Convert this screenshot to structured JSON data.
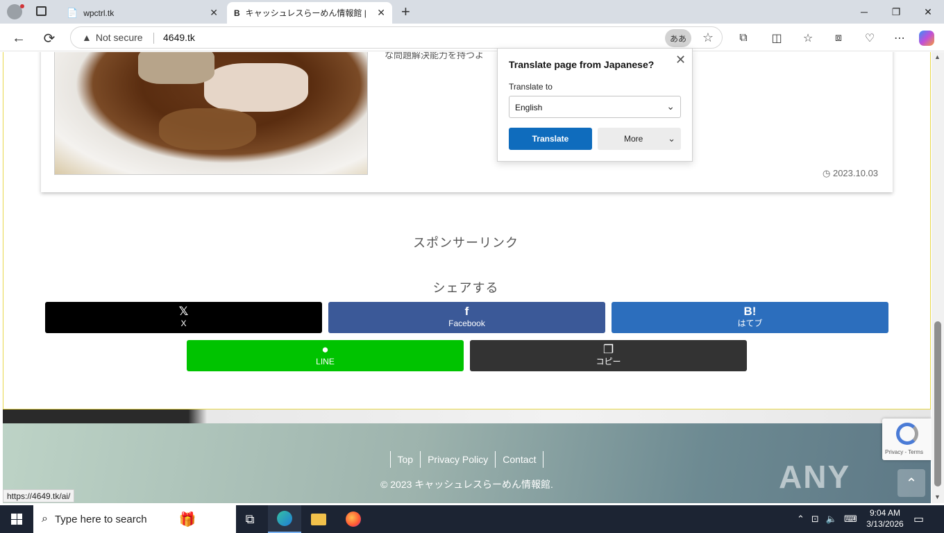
{
  "browser": {
    "tabs": [
      {
        "label": "wpctrl.tk",
        "close": "✕"
      },
      {
        "label": "キャッシュレスらーめん情報館 | らーめん",
        "close": "✕"
      }
    ],
    "new_tab": "+",
    "window_controls": {
      "minimize": "─",
      "restore": "❐",
      "close": "✕"
    },
    "nav": {
      "back": "←",
      "refresh": "⟳"
    },
    "security_label": "Not secure",
    "url": "4649.tk",
    "translate_pill": "ああ",
    "status_url": "https://4649.tk/ai/",
    "toolbar_icons": [
      "extensions-icon",
      "split-screen-icon",
      "favorites-icon",
      "collections-icon",
      "browser-essentials-icon",
      "more-icon",
      "copilot-icon"
    ]
  },
  "translate_popup": {
    "title": "Translate page from Japanese?",
    "close": "✕",
    "label": "Translate to",
    "selected_language": "English",
    "translate_button": "Translate",
    "more_button": "More"
  },
  "page": {
    "excerpt": "な問題解決能力を持つよ",
    "post_date": "2023.10.03",
    "sponsor_title": "スポンサーリンク",
    "share_title": "シェアする",
    "share_buttons": [
      {
        "icon": "𝕏",
        "label": "X",
        "color": "#000000"
      },
      {
        "icon": "f",
        "label": "Facebook",
        "color": "#3b5998"
      },
      {
        "icon": "B!",
        "label": "はてブ",
        "color": "#2c6ebd"
      },
      {
        "icon": "●",
        "label": "LINE",
        "color": "#00c300"
      },
      {
        "icon": "❐",
        "label": "コピー",
        "color": "#333333"
      }
    ],
    "footer_nav": [
      "Top",
      "Privacy Policy",
      "Contact"
    ],
    "copyright": "© 2023 キャッシュレスらーめん情報館.",
    "to_top": "⌃",
    "recaptcha_links": "Privacy - Terms",
    "watermark": "ANY RUN"
  },
  "taskbar": {
    "search_placeholder": "Type here to search",
    "time": "9:04 AM",
    "date": "3/13/2026"
  }
}
